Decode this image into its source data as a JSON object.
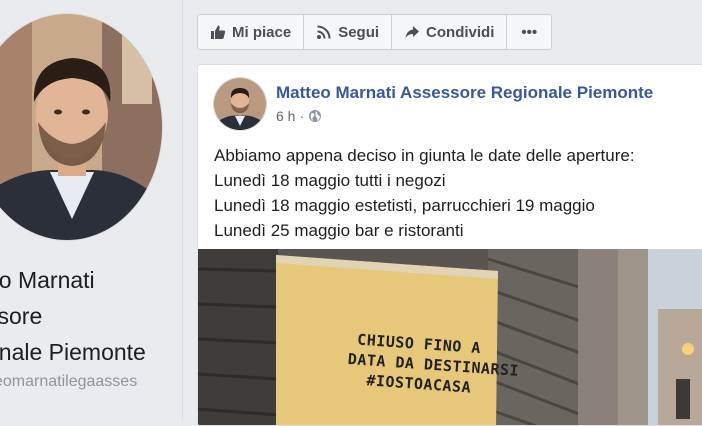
{
  "profile": {
    "name_lines": [
      "eo Marnati",
      "ssore",
      "onale Piemonte"
    ],
    "handle": "eomarnatilegaasses"
  },
  "actions": {
    "like_label": "Mi piace",
    "follow_label": "Segui",
    "share_label": "Condividi",
    "more_label": "•••"
  },
  "post": {
    "author": "Matteo Marnati Assessore Regionale Piemonte",
    "time": "6 h",
    "separator": "·",
    "text_lines": [
      "Abbiamo appena deciso in giunta le date delle aperture:",
      "Lunedì 18 maggio tutti i negozi",
      "Lunedì 18 maggio estetisti, parrucchieri 19 maggio",
      "Lunedì 25 maggio bar e ristoranti"
    ],
    "photo_sign_lines": [
      "CHIUSO FINO A",
      "DATA DA DESTINARSI",
      "#IOSTOACASA"
    ]
  },
  "colors": {
    "brand_link": "#385898",
    "page_bg": "#e9ebee",
    "button_text": "#4b4f56"
  }
}
